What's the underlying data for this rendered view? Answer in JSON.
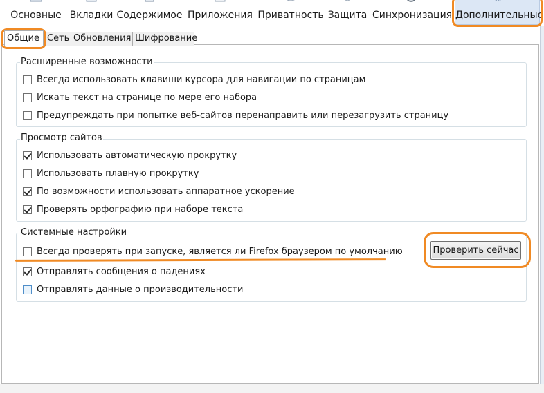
{
  "toolbar": {
    "items": [
      {
        "label": "Основные",
        "icon": "general-icon"
      },
      {
        "label": "Вкладки",
        "icon": "tabs-icon"
      },
      {
        "label": "Содержимое",
        "icon": "content-icon"
      },
      {
        "label": "Приложения",
        "icon": "applications-icon"
      },
      {
        "label": "Приватность",
        "icon": "privacy-icon"
      },
      {
        "label": "Защита",
        "icon": "security-icon"
      },
      {
        "label": "Синхронизация",
        "icon": "sync-icon"
      },
      {
        "label": "Дополнительные",
        "icon": "gear-icon",
        "active": true
      }
    ]
  },
  "subtabs": [
    {
      "label": "Общие",
      "active": true
    },
    {
      "label": "Сеть"
    },
    {
      "label": "Обновления"
    },
    {
      "label": "Шифрование"
    }
  ],
  "groups": {
    "accessibility": {
      "title": "Расширенные возможности",
      "items": [
        {
          "label": "Всегда использовать клавиши курсора для навигации по страницам",
          "checked": false
        },
        {
          "label": "Искать текст на странице по мере его набора",
          "checked": false
        },
        {
          "label": "Предупреждать при попытке веб-сайтов перенаправить или перезагрузить страницу",
          "checked": false
        }
      ]
    },
    "browsing": {
      "title": "Просмотр сайтов",
      "items": [
        {
          "label": "Использовать автоматическую прокрутку",
          "checked": true
        },
        {
          "label": "Использовать плавную прокрутку",
          "checked": false
        },
        {
          "label": "По возможности использовать аппаратное ускорение",
          "checked": true
        },
        {
          "label": "Проверять орфографию при наборе текста",
          "checked": true
        }
      ]
    },
    "system": {
      "title": "Системные настройки",
      "items": [
        {
          "label": "Всегда проверять при запуске, является ли Firefox браузером по умолчанию",
          "checked": false
        },
        {
          "label": "Отправлять сообщения о падениях",
          "checked": true
        },
        {
          "label": "Отправлять данные о производительности",
          "checked": false
        }
      ],
      "check_now_label": "Проверить сейчас"
    }
  },
  "colors": {
    "annotation": "#f08a24",
    "active_tab_bg": "#dce7f5"
  }
}
